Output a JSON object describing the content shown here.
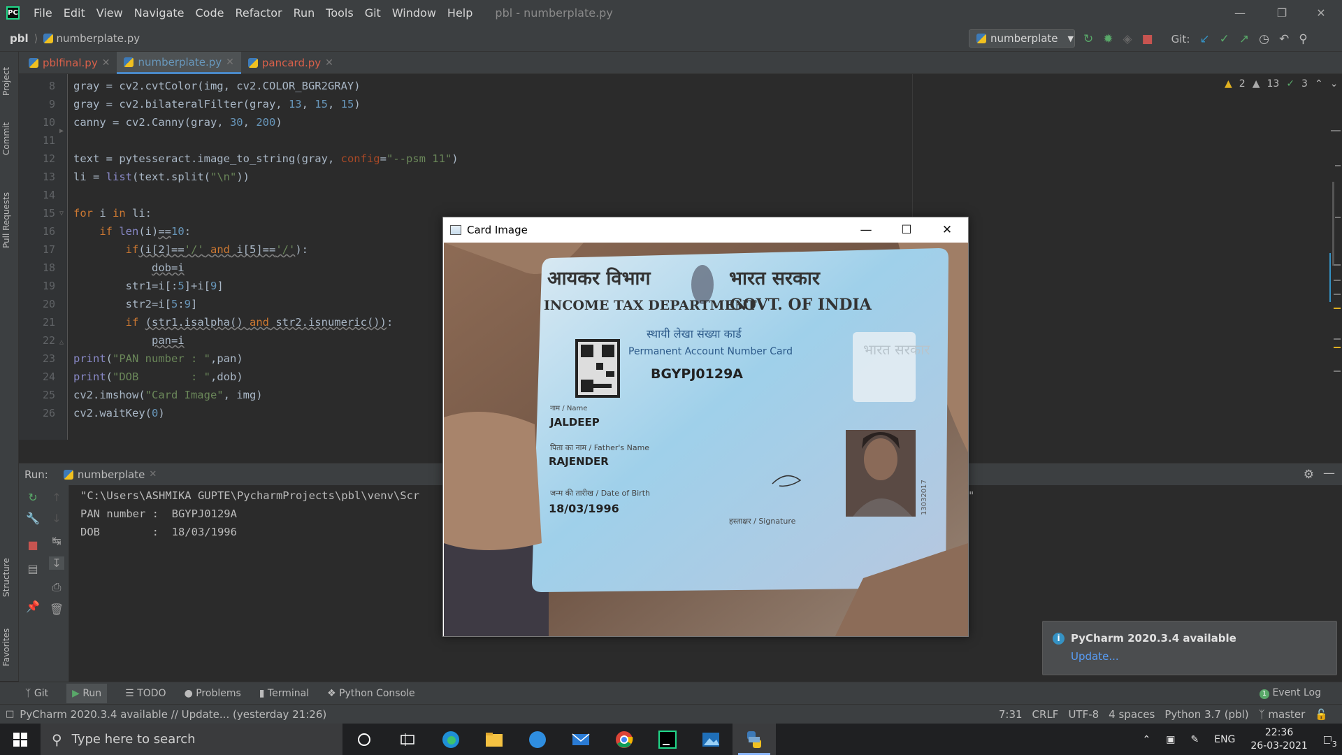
{
  "titlebar": {
    "app_icon": "PC",
    "menu": [
      "File",
      "Edit",
      "View",
      "Navigate",
      "Code",
      "Refactor",
      "Run",
      "Tools",
      "Git",
      "Window",
      "Help"
    ],
    "title": "pbl - numberplate.py"
  },
  "navbar": {
    "project": "pbl",
    "file": "numberplate.py",
    "run_config": "numberplate",
    "git_label": "Git:"
  },
  "left_tools": [
    "Project",
    "Commit",
    "Pull Requests",
    "Structure",
    "Favorites"
  ],
  "tabs": [
    {
      "label": "pblfinal.py",
      "color": "#d8604a"
    },
    {
      "label": "numberplate.py",
      "color": "#6897bb"
    },
    {
      "label": "pancard.py",
      "color": "#d8604a"
    }
  ],
  "inspections": {
    "warnings_a": "2",
    "warnings_b": "13",
    "ok": "3"
  },
  "line_numbers": [
    "8",
    "9",
    "10",
    "11",
    "12",
    "13",
    "14",
    "15",
    "16",
    "17",
    "18",
    "19",
    "20",
    "21",
    "22",
    "23",
    "24",
    "25",
    "26"
  ],
  "code": {
    "l8": [
      "gray = cv2.cvtColor(img, cv2.COLOR_BGR2GRAY)"
    ],
    "l9a": "gray = cv2.bilateralFilter(gray, ",
    "l9b": "13",
    "l9c": "15",
    "l9d": "15",
    "l10a": "canny = cv2.Canny(gray, ",
    "l10b": "30",
    "l10c": "200",
    "l12a": "text = pytesseract.image_to_string(gray, ",
    "l12b": "config",
    "l12c": "\"--psm 11\"",
    "l13a": "li = ",
    "l13b": "list",
    "l13c": "(text.split(",
    "l13d": "\"\\n\"",
    "l13e": "))",
    "l15a": "for",
    "l15b": " i ",
    "l15c": "in",
    "l15d": " li:",
    "l16a": "if",
    "l16b": "len",
    "l16c": "(i)",
    "l16d": "==",
    "l16e": "10",
    "l16f": ":",
    "l17a": "if",
    "l17b": "(i[2]==",
    "l17c": "'/'",
    "l17d": "and",
    "l17e": " i[5]==",
    "l17f": "'/'",
    "l17g": "):",
    "l18": "dob=i",
    "l19a": "str1=i[:",
    "l19b": "5",
    "l19c": "]+i[",
    "l19d": "9",
    "l19e": "]",
    "l20a": "str2=i[",
    "l20b": "5",
    "l20c": ":",
    "l20d": "9",
    "l20e": "]",
    "l21a": "if",
    "l21b": "(str1.isalpha() ",
    "l21c": "and",
    "l21d": " str2.isnumeric())",
    "l22": "pan=i",
    "l23a": "print",
    "l23b": "(",
    "l23c": "\"PAN number : \"",
    "l23d": ",pan)",
    "l24a": "print",
    "l24b": "(",
    "l24c": "\"DOB        : \"",
    "l24d": ",dob)",
    "l25a": "cv2.imshow(",
    "l25b": "\"Card Image\"",
    "l25c": ", img)",
    "l26a": "cv2.waitKey(",
    "l26b": "0",
    "l26c": ")"
  },
  "run_panel": {
    "label": "Run:",
    "tab": "numberplate",
    "output": [
      "\"C:\\Users\\ASHMIKA GUPTE\\PycharmProjects\\pbl\\venv\\Scr",
      "PAN number :  BGYPJ0129A",
      "DOB        :  18/03/1996"
    ],
    "trailing_quote": "\""
  },
  "card_window": {
    "title": "Card Image",
    "card": {
      "hindi_left": "आयकर विभाग",
      "hindi_right": "भारत सरकार",
      "dept": "INCOME TAX DEPARTMENT",
      "govt": "GOVT. OF INDIA",
      "hindi_card": "स्थायी लेखा संख्या कार्ड",
      "card_title": "Permanent Account Number Card",
      "pan": "BGYPJ0129A",
      "name_label": "नाम / Name",
      "name": "JALDEEP",
      "father_label": "पिता का नाम / Father's Name",
      "father": "RAJENDER",
      "dob_label": "जन्म की तारीख / Date of Birth",
      "dob": "18/03/1996",
      "sign_label": "हस्ताक्षर / Signature",
      "hologram": "भारत सरकार",
      "side_number": "13032017"
    }
  },
  "notification": {
    "title": "PyCharm 2020.3.4 available",
    "link": "Update..."
  },
  "bottom_tools": [
    "Git",
    "Run",
    "TODO",
    "Problems",
    "Terminal",
    "Python Console"
  ],
  "event_log": {
    "count": "1",
    "label": "Event Log"
  },
  "status": {
    "message": "PyCharm 2020.3.4 available // Update... (yesterday 21:26)",
    "position": "7:31",
    "line_sep": "CRLF",
    "encoding": "UTF-8",
    "indent": "4 spaces",
    "interpreter": "Python 3.7 (pbl)",
    "branch": "master"
  },
  "taskbar": {
    "search_placeholder": "Type here to search",
    "lang": "ENG",
    "time": "22:36",
    "date": "26-03-2021",
    "notif_count": "3"
  },
  "colors": {
    "accent": "#4a88c7",
    "keyword": "#cc7832",
    "string": "#6a8759",
    "number": "#6897bb"
  }
}
